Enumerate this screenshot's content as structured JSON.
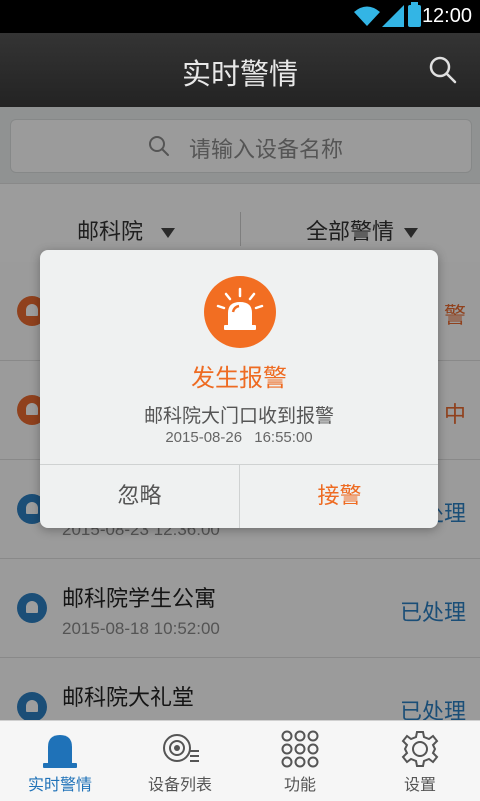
{
  "status_bar": {
    "time": "12:00"
  },
  "header": {
    "title": "实时警情"
  },
  "search": {
    "placeholder": "请输入设备名称"
  },
  "filters": {
    "location": "邮科院",
    "alarm_type": "全部警情"
  },
  "alarms": [
    {
      "name": "",
      "date": "",
      "status": "警",
      "status_color": "#e8692f",
      "icon": "alarm-orange-icon"
    },
    {
      "name": "",
      "date": "",
      "status": "中",
      "status_color": "#e8692f",
      "icon": "alarm-orange-icon"
    },
    {
      "name": "",
      "date": "2015-08-23 12:36:00",
      "status": "处理",
      "status_color": "#2b7ec0",
      "icon": "alarm-blue-icon"
    },
    {
      "name": "邮科院学生公寓",
      "date": "2015-08-18 10:52:00",
      "status": "已处理",
      "status_color": "#2b7ec0",
      "icon": "alarm-blue-icon"
    },
    {
      "name": "邮科院大礼堂",
      "date": "",
      "status": "已处理",
      "status_color": "#2b7ec0",
      "icon": "alarm-blue-icon"
    }
  ],
  "dialog": {
    "title": "发生报警",
    "message": "邮科院大门口收到报警",
    "time": "2015-08-26 16:55:00",
    "ignore_label": "忽略",
    "accept_label": "接警",
    "accent_color": "#f26e22"
  },
  "tabs": [
    {
      "label": "实时警情",
      "icon": "siren-icon",
      "active": true
    },
    {
      "label": "设备列表",
      "icon": "camera-list-icon",
      "active": false
    },
    {
      "label": "功能",
      "icon": "grid-icon",
      "active": false
    },
    {
      "label": "设置",
      "icon": "gear-icon",
      "active": false
    }
  ]
}
